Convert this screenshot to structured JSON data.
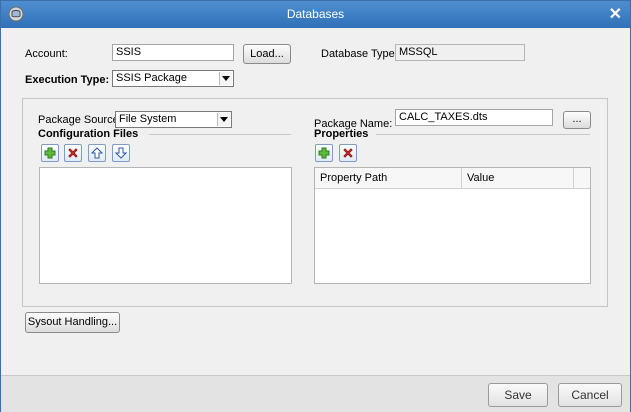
{
  "window": {
    "title": "Databases"
  },
  "account": {
    "label": "Account:",
    "value": "SSIS",
    "load_label": "Load..."
  },
  "database_type": {
    "label": "Database Type:",
    "value": "MSSQL"
  },
  "execution_type": {
    "label": "Execution Type:",
    "value": "SSIS Package"
  },
  "package_source": {
    "label": "Package Source:",
    "value": "File System"
  },
  "package_name": {
    "label": "Package Name:",
    "value": "CALC_TAXES.dts",
    "browse_label": "..."
  },
  "config_files": {
    "heading": "Configuration Files"
  },
  "properties": {
    "heading": "Properties",
    "columns": [
      "Property Path",
      "Value"
    ]
  },
  "sysout": {
    "label": "Sysout Handling..."
  },
  "footer": {
    "save_label": "Save",
    "cancel_label": "Cancel"
  },
  "icons": {
    "add": "add-icon",
    "remove": "remove-icon",
    "up": "arrow-up-icon",
    "down": "arrow-down-icon"
  }
}
